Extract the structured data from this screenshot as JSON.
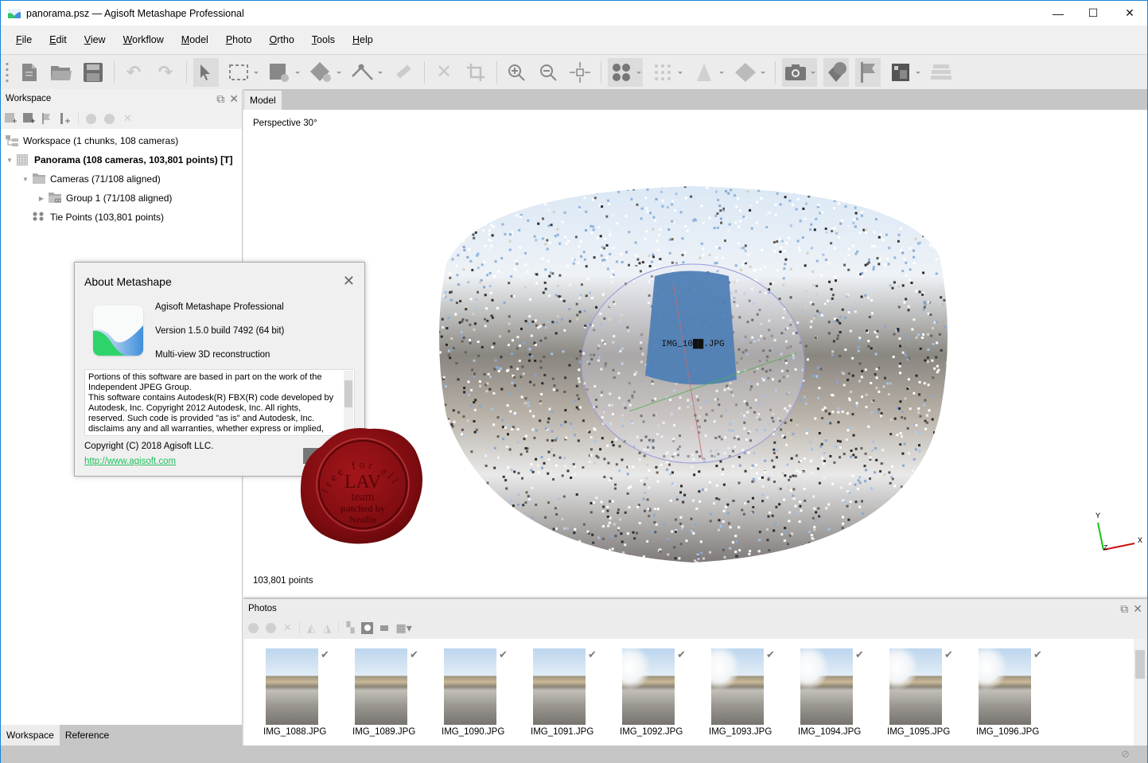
{
  "window": {
    "title": "panorama.psz — Agisoft Metashape Professional",
    "controls": {
      "minimize": "—",
      "maximize": "☐",
      "close": "✕"
    }
  },
  "menubar": {
    "items": [
      {
        "label": "File",
        "accel": "F",
        "rest": "ile"
      },
      {
        "label": "Edit",
        "accel": "E",
        "rest": "dit"
      },
      {
        "label": "View",
        "accel": "V",
        "rest": "iew"
      },
      {
        "label": "Workflow",
        "accel": "W",
        "rest": "orkflow"
      },
      {
        "label": "Model",
        "accel": "M",
        "rest": "odel"
      },
      {
        "label": "Photo",
        "accel": "P",
        "rest": "hoto"
      },
      {
        "label": "Ortho",
        "accel": "O",
        "rest": "rtho"
      },
      {
        "label": "Tools",
        "accel": "T",
        "rest": "ools"
      },
      {
        "label": "Help",
        "accel": "H",
        "rest": "elp"
      }
    ]
  },
  "toolbar": {
    "icons": [
      "new-document",
      "open-folder",
      "save-disk",
      "undo",
      "redo",
      "navigation-arrow",
      "rectangle-selection",
      "model-hand",
      "shape-hand",
      "ruler-point",
      "eraser-ruler",
      "delete-x",
      "crop",
      "zoom-in",
      "zoom-out",
      "reset-view",
      "point-cloud",
      "dense-cloud",
      "tiled-model",
      "mesh-model",
      "camera",
      "shapes",
      "markers-flag",
      "ortho-image",
      "layers"
    ]
  },
  "workspace_panel": {
    "title": "Workspace",
    "tree": [
      {
        "label": "Workspace (1 chunks, 108 cameras)",
        "level": 0,
        "bold": false,
        "icon": "workspace-icon"
      },
      {
        "label": "Panorama (108 cameras, 103,801 points) [T]",
        "level": 0,
        "bold": true,
        "icon": "chunk-icon",
        "expanded": true
      },
      {
        "label": "Cameras (71/108 aligned)",
        "level": 1,
        "bold": false,
        "icon": "folder-icon",
        "expanded": true
      },
      {
        "label": "Group 1 (71/108 aligned)",
        "level": 2,
        "bold": false,
        "icon": "camera-group-icon",
        "expanded": false
      },
      {
        "label": "Tie Points (103,801 points)",
        "level": 1,
        "bold": false,
        "icon": "tie-points-icon"
      }
    ],
    "bottom_tabs": [
      "Workspace",
      "Reference"
    ]
  },
  "model_view": {
    "tab": "Model",
    "projection": "Perspective 30°",
    "camera_label": "IMG_10██.JPG",
    "point_count": "103,801 points",
    "axes": {
      "x": "X",
      "y": "Y",
      "z": "Z"
    }
  },
  "photos_panel": {
    "title": "Photos",
    "photos": [
      {
        "name": "IMG_1088.JPG",
        "aligned": true
      },
      {
        "name": "IMG_1089.JPG",
        "aligned": true
      },
      {
        "name": "IMG_1090.JPG",
        "aligned": true
      },
      {
        "name": "IMG_1091.JPG",
        "aligned": true
      },
      {
        "name": "IMG_1092.JPG",
        "aligned": true
      },
      {
        "name": "IMG_1093.JPG",
        "aligned": true
      },
      {
        "name": "IMG_1094.JPG",
        "aligned": true
      },
      {
        "name": "IMG_1095.JPG",
        "aligned": true
      },
      {
        "name": "IMG_1096.JPG",
        "aligned": true
      }
    ]
  },
  "about_dialog": {
    "title": "About Metashape",
    "product": "Agisoft Metashape Professional",
    "version": "Version 1.5.0 build 7492 (64 bit)",
    "tagline": "Multi-view 3D reconstruction",
    "license_lines": [
      "Portions of this software are based in part on the work of the",
      "Independent JPEG Group.",
      "This software contains Autodesk(R) FBX(R) code developed by",
      "Autodesk, Inc. Copyright 2012 Autodesk, Inc. All rights,",
      "reserved. Such code is provided \"as is\" and Autodesk, Inc.",
      "disclaims any and all warranties, whether express or implied,"
    ],
    "copyright": "Copyright (C) 2018 Agisoft LLC.",
    "link": "http://www.agisoft.com"
  },
  "seal": {
    "top_text": "free for all",
    "main": "LAV",
    "line2": "team",
    "line3": "patched by",
    "line4": "Neofin"
  },
  "colors": {
    "accent_blue": "#1883d7",
    "link_green": "#1fc05a",
    "seal_red": "#8c0f14",
    "camera_plane": "#4f7fb5"
  }
}
